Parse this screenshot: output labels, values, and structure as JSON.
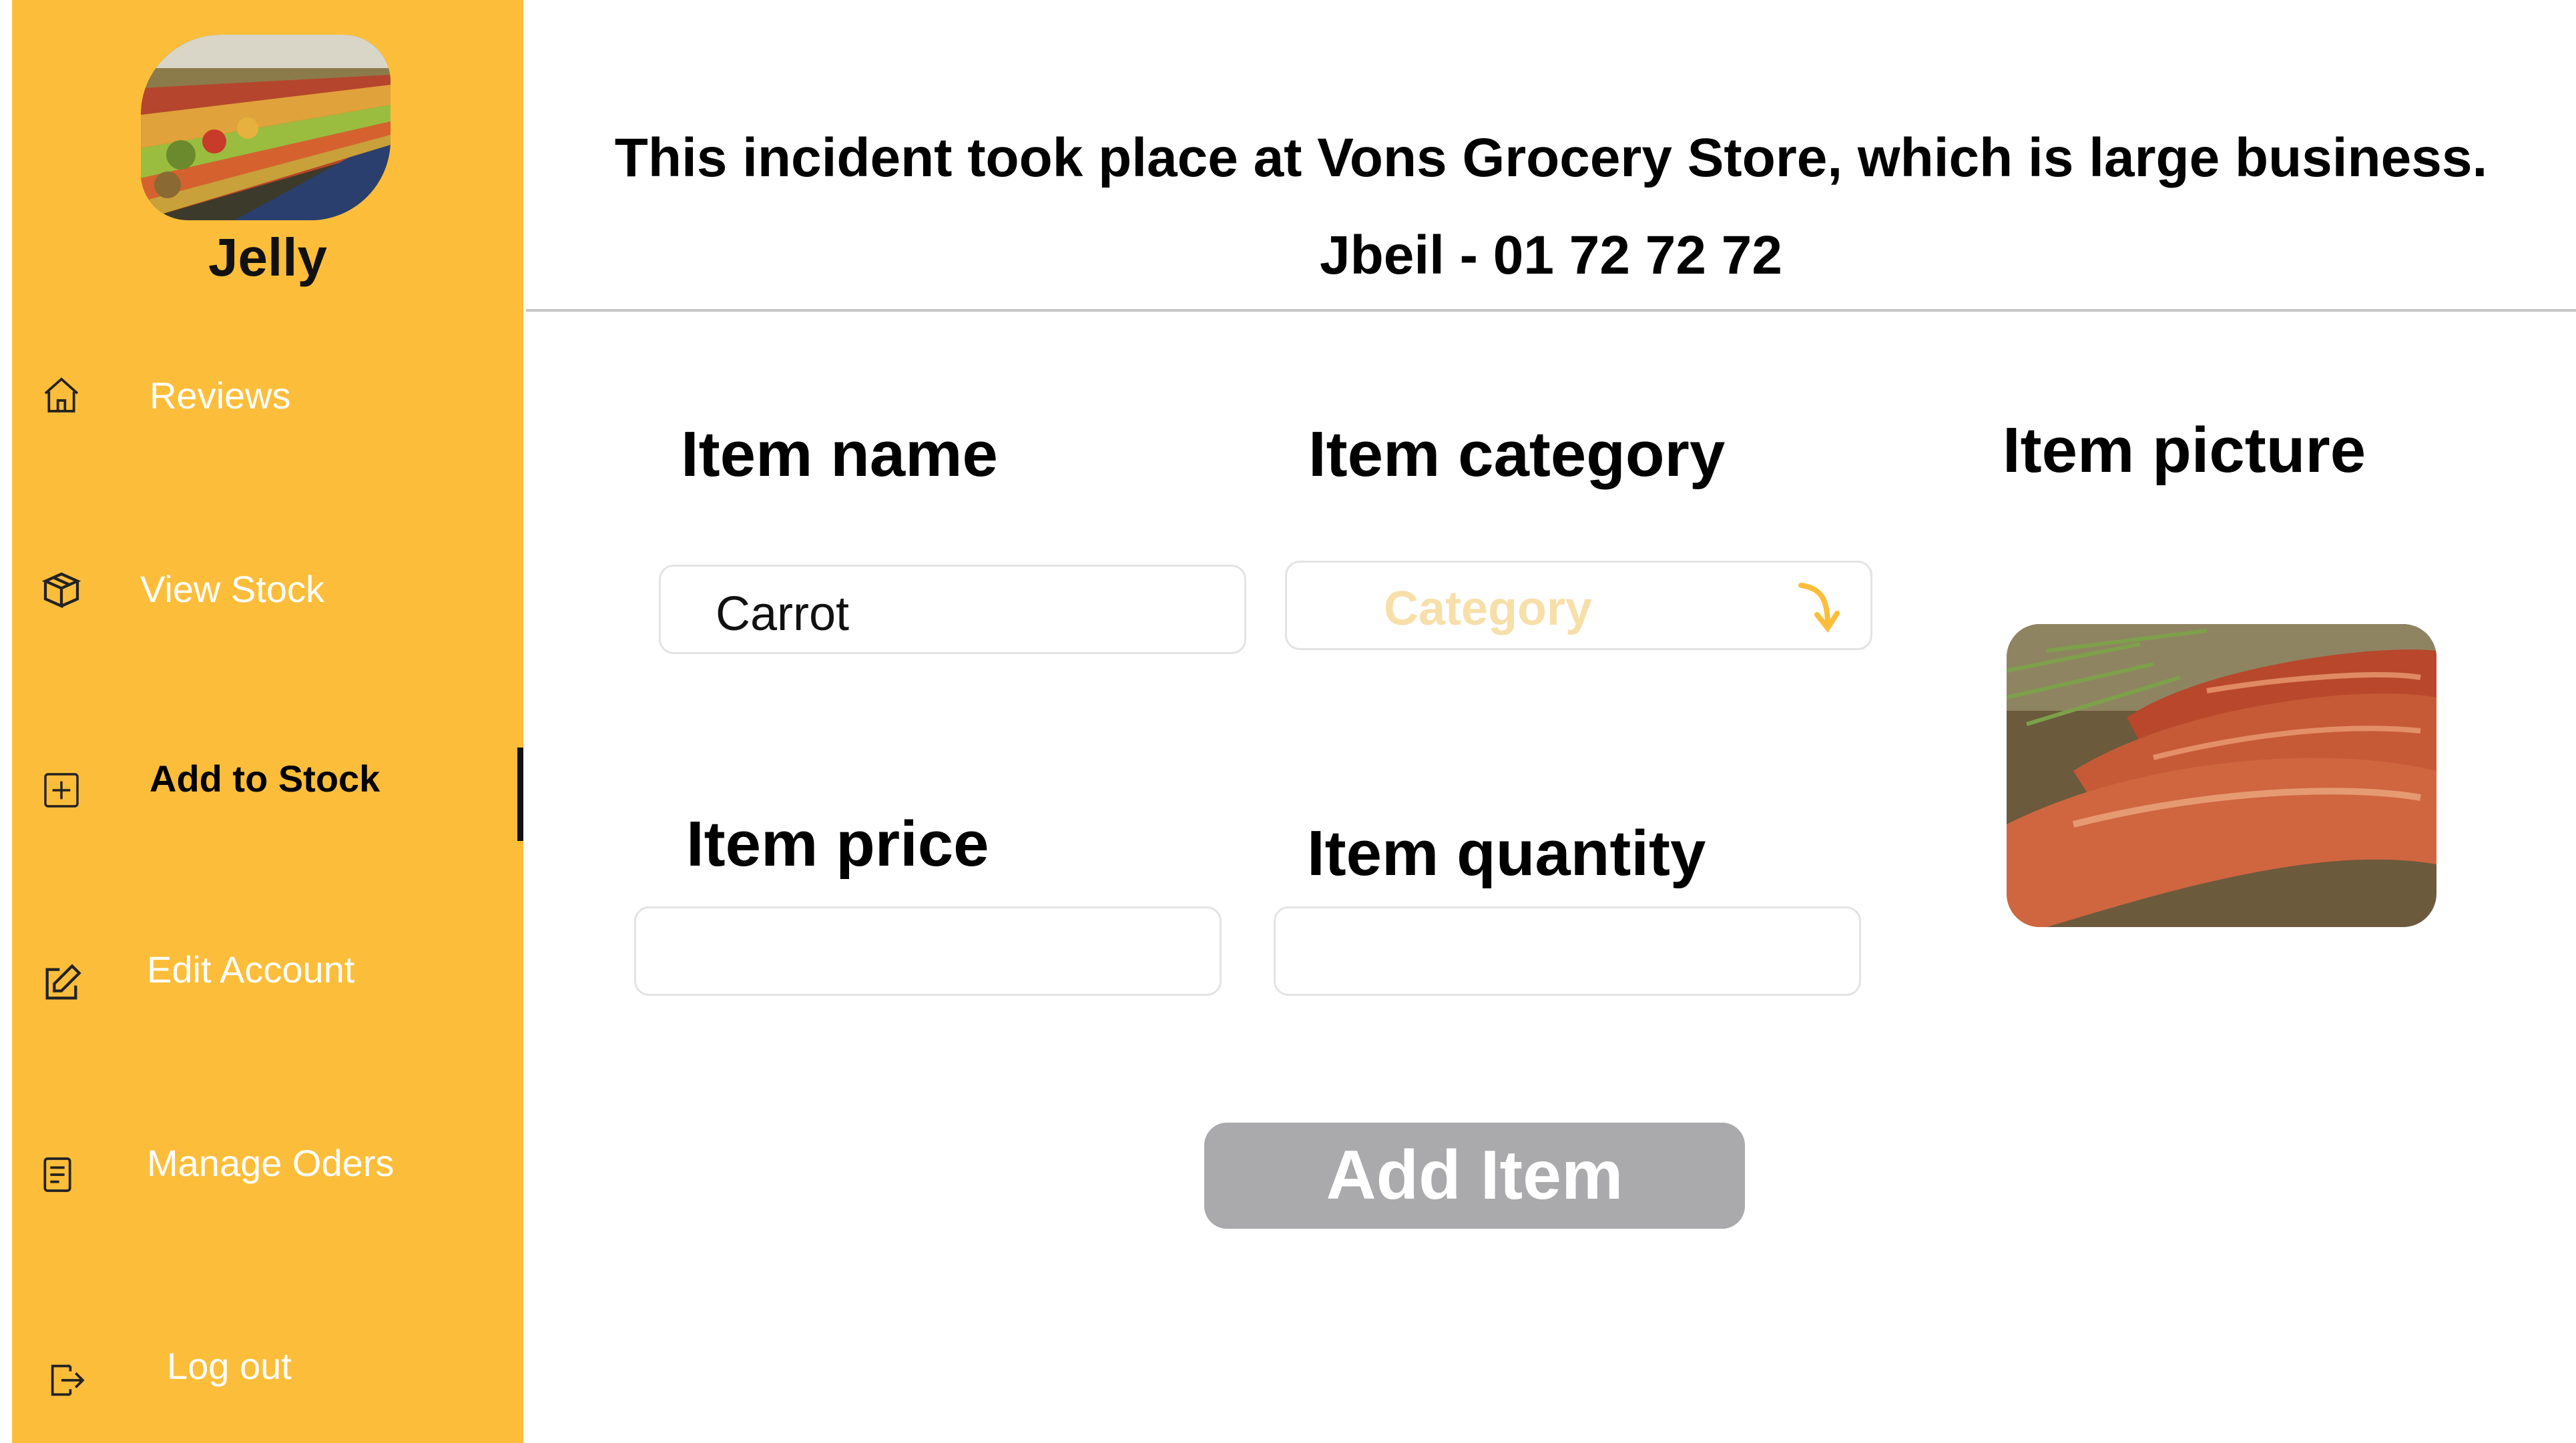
{
  "sidebar": {
    "store_name": "Jelly",
    "items": [
      {
        "label": "Reviews",
        "icon": "home-icon"
      },
      {
        "label": "View Stock",
        "icon": "box-icon"
      },
      {
        "label": "Add to Stock",
        "icon": "plus-square-icon",
        "active": true
      },
      {
        "label": "Edit Account",
        "icon": "edit-icon"
      },
      {
        "label": "Manage Oders",
        "icon": "receipt-icon"
      },
      {
        "label": "Log out",
        "icon": "logout-icon"
      }
    ]
  },
  "header": {
    "title": "This incident took place at Vons Grocery Store, which is large business.",
    "subtitle": "Jbeil - 01 72 72 72"
  },
  "form": {
    "item_name_label": "Item name",
    "item_name_value": "Carrot",
    "item_category_label": "Item category",
    "item_category_placeholder": "Category",
    "item_picture_label": "Item picture",
    "item_price_label": "Item price",
    "item_price_value": "",
    "item_quantity_label": "Item quantity",
    "item_quantity_value": "",
    "submit_label": "Add Item"
  },
  "colors": {
    "sidebar_bg": "#FCBE3A",
    "button_bg": "#AAA9AB",
    "placeholder": "#F6DFA9"
  }
}
